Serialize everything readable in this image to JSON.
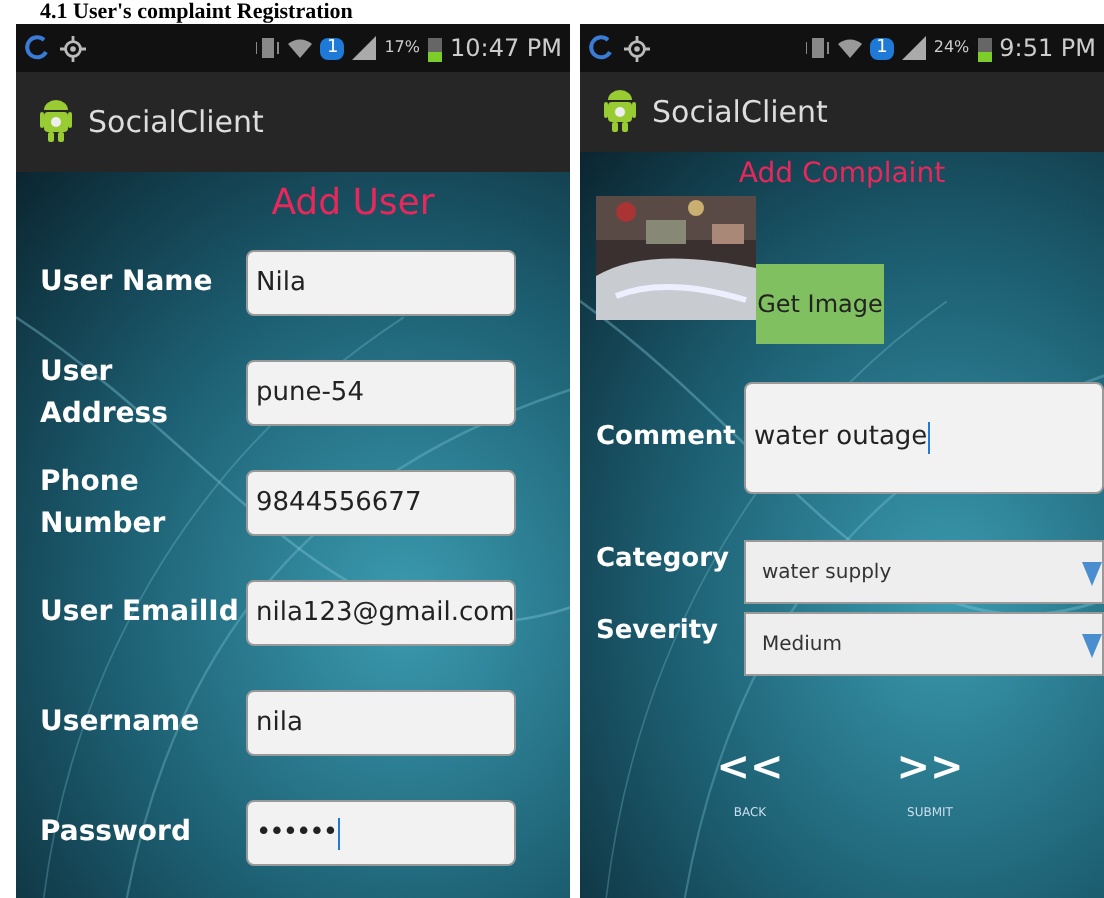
{
  "caption": "4.1 User's complaint Registration",
  "user_screen": {
    "status_bar": {
      "sim": "1",
      "battery": "17%",
      "time": "10:47 PM"
    },
    "app_title": "SocialClient",
    "heading": "Add User",
    "fields": [
      {
        "label": "User Name",
        "value": "Nila",
        "kind": "text"
      },
      {
        "label": "User Address",
        "value": "pune-54",
        "kind": "text"
      },
      {
        "label": "Phone Number",
        "value": "9844556677",
        "kind": "text"
      },
      {
        "label": "User EmailId",
        "value": "nila123@gmail.com",
        "kind": "text"
      },
      {
        "label": "Username",
        "value": "nila",
        "kind": "text"
      },
      {
        "label": "Password",
        "value": "••••••",
        "kind": "password"
      }
    ]
  },
  "complaint_screen": {
    "status_bar": {
      "sim": "1",
      "battery": "24%",
      "time": "9:51 PM"
    },
    "app_title": "SocialClient",
    "heading": "Add Complaint",
    "get_image_button": "Get Image",
    "comment": {
      "label": "Comment",
      "value": "water outage"
    },
    "dropdowns": [
      {
        "label": "Category",
        "value": "water supply"
      },
      {
        "label": "Severity",
        "value": "Medium"
      }
    ],
    "nav": [
      {
        "symbol": "<<",
        "label": "BACK"
      },
      {
        "symbol": ">>",
        "label": "SUBMIT"
      }
    ]
  }
}
